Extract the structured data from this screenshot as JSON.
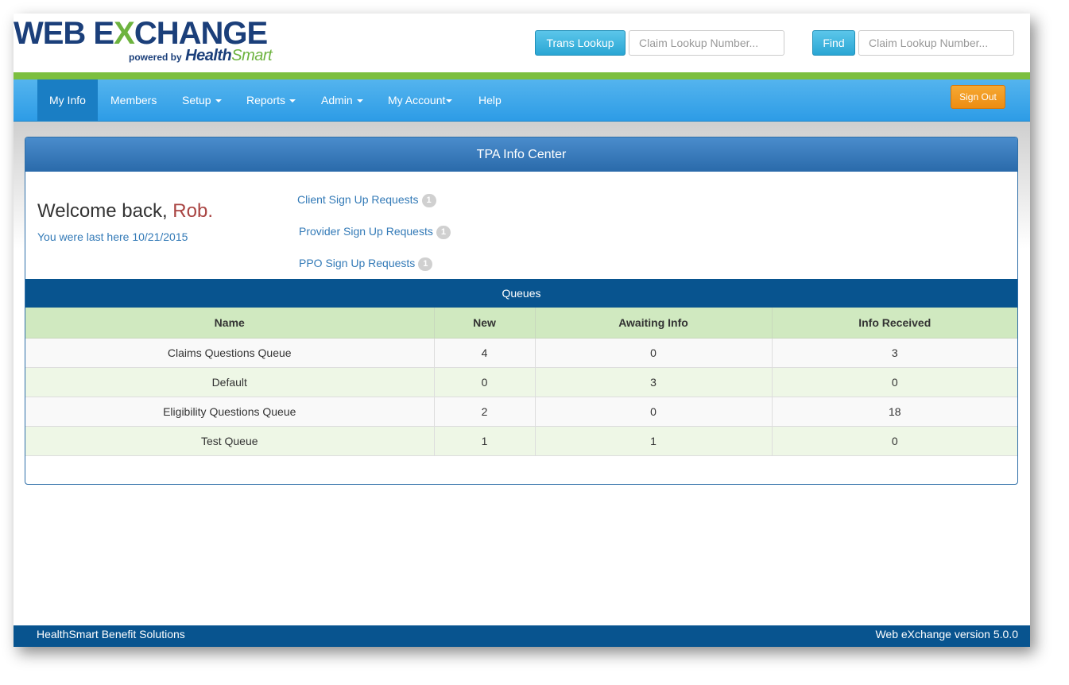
{
  "header": {
    "logo": {
      "main_web": "WEB E",
      "main_x": "X",
      "main_change": "CHANGE",
      "powered_by": "powered by",
      "brand_health": "Health",
      "brand_smart": "Smart"
    },
    "trans_lookup_label": "Trans Lookup",
    "trans_lookup_placeholder": "Claim Lookup Number...",
    "find_label": "Find",
    "find_placeholder": "Claim Lookup Number..."
  },
  "nav": {
    "items": [
      {
        "label": "My Info",
        "active": true
      },
      {
        "label": "Members"
      },
      {
        "label": "Setup"
      },
      {
        "label": "Reports"
      },
      {
        "label": "Admin"
      },
      {
        "label": "My Account"
      },
      {
        "label": "Help"
      }
    ],
    "sign_out_label": "Sign Out"
  },
  "panel": {
    "title": "TPA Info Center",
    "welcome_prefix": "Welcome back, ",
    "welcome_name": "Rob.",
    "last_visit": "You were last here 10/21/2015",
    "requests": [
      {
        "label": "Client Sign Up Requests",
        "count": "1"
      },
      {
        "label": "Provider Sign Up Requests",
        "count": "1"
      },
      {
        "label": "PPO Sign Up Requests",
        "count": "1"
      }
    ]
  },
  "queues": {
    "title": "Queues",
    "columns": [
      "Name",
      "New",
      "Awaiting Info",
      "Info Received"
    ],
    "rows": [
      [
        "Claims Questions Queue",
        "4",
        "0",
        "3"
      ],
      [
        "Default",
        "0",
        "3",
        "0"
      ],
      [
        "Eligibility Questions Queue",
        "2",
        "0",
        "18"
      ],
      [
        "Test Queue",
        "1",
        "1",
        "0"
      ]
    ]
  },
  "footer": {
    "left": "HealthSmart Benefit Solutions",
    "right": "Web eXchange version 5.0.0"
  },
  "colors": {
    "brand_navy": "#1b3f7a",
    "brand_green": "#6db33f",
    "nav_blue": "#2d9ce6",
    "dark_blue": "#08548f",
    "sign_out_orange": "#ed8d12",
    "welcome_name_red": "#a94442"
  }
}
